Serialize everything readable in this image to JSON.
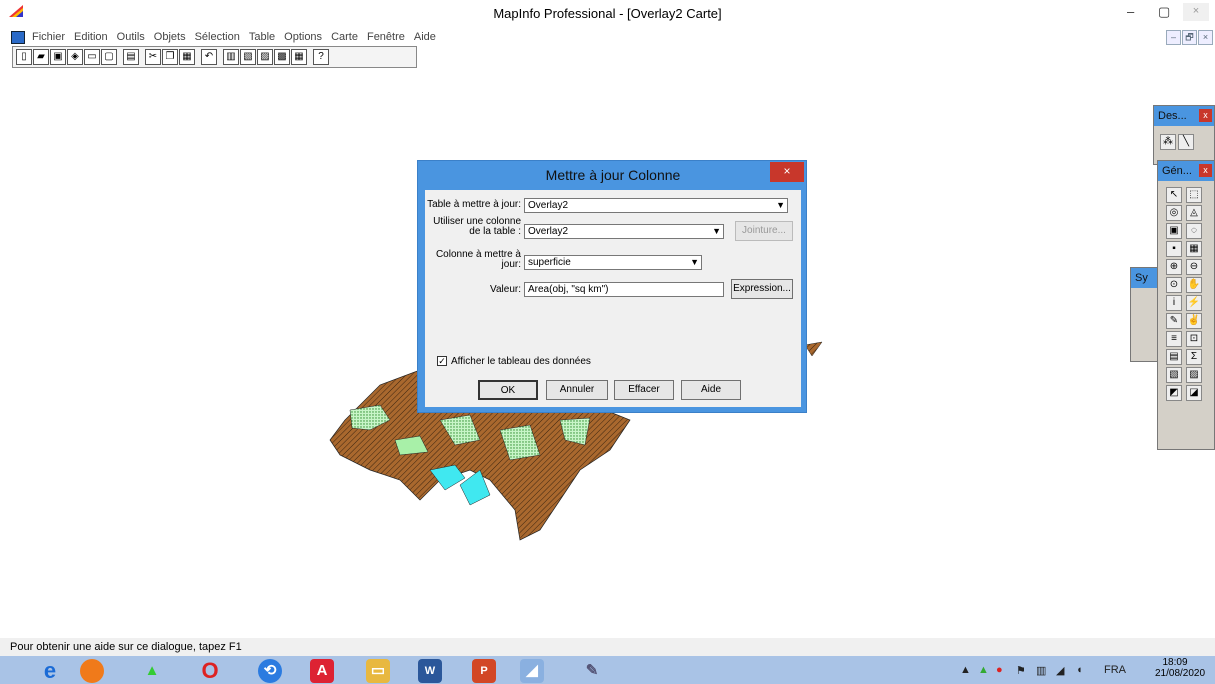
{
  "window": {
    "title": "MapInfo Professional - [Overlay2 Carte]",
    "minimize": "–",
    "maximize": "▢",
    "close": "×"
  },
  "menu": [
    "Fichier",
    "Edition",
    "Outils",
    "Objets",
    "Sélection",
    "Table",
    "Options",
    "Carte",
    "Fenêtre",
    "Aide"
  ],
  "mdi_buttons": [
    "–",
    "🗗",
    "×"
  ],
  "dialog": {
    "title": "Mettre à jour Colonne",
    "close": "×",
    "table_label": "Table à mettre à jour:",
    "table_value": "Overlay2",
    "use_column_label_1": "Utiliser une colonne",
    "use_column_label_2": "de la table :",
    "use_column_value": "Overlay2",
    "join_button": "Jointure...",
    "column_label_1": "Colonne à mettre à",
    "column_label_2": "jour:",
    "column_value": "superficie",
    "value_label": "Valeur:",
    "value_value": "Area(obj, \"sq km\")",
    "expression_button": "Expression...",
    "checkbox_label": "Afficher le tableau des données",
    "checkbox_checked": true,
    "ok": "OK",
    "cancel": "Annuler",
    "clear": "Effacer",
    "help": "Aide"
  },
  "palettes": {
    "des_title": "Des...",
    "gen_title": "Gén...",
    "sy_title": "Sy"
  },
  "status": "Pour obtenir une aide sur ce dialogue, tapez F1",
  "tray": {
    "lang": "FRA",
    "time": "18:09",
    "date": "21/08/2020"
  },
  "colors": {
    "accent": "#4a95e0",
    "close": "#c8372b",
    "map_brown": "#a9682e",
    "map_cyan": "#40e8f0",
    "map_green": "#a8f0a8"
  }
}
